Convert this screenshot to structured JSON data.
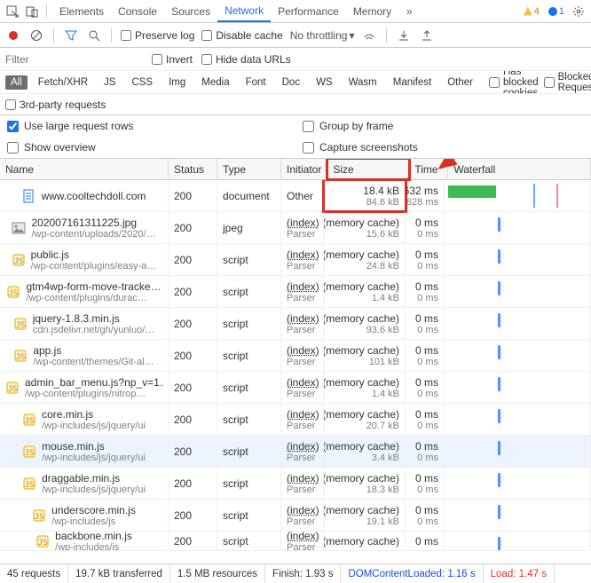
{
  "tabs": {
    "items": [
      "Elements",
      "Console",
      "Sources",
      "Network",
      "Performance",
      "Memory"
    ],
    "active": "Network",
    "warn_count": "4",
    "info_count": "1"
  },
  "toolbar": {
    "preserve_log": "Preserve log",
    "disable_cache": "Disable cache",
    "throttling": "No throttling"
  },
  "filter": {
    "placeholder": "Filter",
    "invert": "Invert",
    "hide_data_urls": "Hide data URLs",
    "kinds": [
      "All",
      "Fetch/XHR",
      "JS",
      "CSS",
      "Img",
      "Media",
      "Font",
      "Doc",
      "WS",
      "Wasm",
      "Manifest",
      "Other"
    ],
    "kinds_active": "All",
    "blocked_cookies": "Has blocked cookies",
    "blocked_req": "Blocked Requests",
    "third_party": "3rd-party requests"
  },
  "options": {
    "large_rows": "Use large request rows",
    "group_frame": "Group by frame",
    "show_overview": "Show overview",
    "capture": "Capture screenshots"
  },
  "columns": {
    "name": "Name",
    "status": "Status",
    "type": "Type",
    "initiator": "Initiator",
    "size": "Size",
    "time": "Time",
    "waterfall": "Waterfall"
  },
  "rows": [
    {
      "icon": "doc",
      "name": "www.cooltechdoll.com",
      "path": "",
      "status": "200",
      "type": "document",
      "init1": "Other",
      "init2": "",
      "size1": "18.4 kB",
      "size2": "84.6 kB",
      "time1": "632 ms",
      "time2": "628 ms",
      "wf": "green",
      "sizeBox": true
    },
    {
      "icon": "img",
      "name": "202007161311225.jpg",
      "path": "/wp-content/uploads/2020/…",
      "status": "200",
      "type": "jpeg",
      "init1": "(index)",
      "init2": "Parser",
      "size1": "(memory cache)",
      "size2": "15.6 kB",
      "time1": "0 ms",
      "time2": "0 ms",
      "wf": "tick"
    },
    {
      "icon": "js",
      "name": "public.js",
      "path": "/wp-content/plugins/easy-a…",
      "status": "200",
      "type": "script",
      "init1": "(index)",
      "init2": "Parser",
      "size1": "(memory cache)",
      "size2": "24.8 kB",
      "time1": "0 ms",
      "time2": "0 ms",
      "wf": "tick"
    },
    {
      "icon": "js",
      "name": "gtm4wp-form-move-tracke…",
      "path": "/wp-content/plugins/durac…",
      "status": "200",
      "type": "script",
      "init1": "(index)",
      "init2": "Parser",
      "size1": "(memory cache)",
      "size2": "1.4 kB",
      "time1": "0 ms",
      "time2": "0 ms",
      "wf": "tick"
    },
    {
      "icon": "js",
      "name": "jquery-1.8.3.min.js",
      "path": "cdn.jsdelivr.net/gh/yunluo/…",
      "status": "200",
      "type": "script",
      "init1": "(index)",
      "init2": "Parser",
      "size1": "(memory cache)",
      "size2": "93.6 kB",
      "time1": "0 ms",
      "time2": "0 ms",
      "wf": "tick"
    },
    {
      "icon": "js",
      "name": "app.js",
      "path": "/wp-content/themes/Git-al…",
      "status": "200",
      "type": "script",
      "init1": "(index)",
      "init2": "Parser",
      "size1": "(memory cache)",
      "size2": "101 kB",
      "time1": "0 ms",
      "time2": "0 ms",
      "wf": "tick"
    },
    {
      "icon": "js",
      "name": "admin_bar_menu.js?np_v=1…",
      "path": "/wp-content/plugins/nitrop…",
      "status": "200",
      "type": "script",
      "init1": "(index)",
      "init2": "Parser",
      "size1": "(memory cache)",
      "size2": "1.4 kB",
      "time1": "0 ms",
      "time2": "0 ms",
      "wf": "tick"
    },
    {
      "icon": "js",
      "name": "core.min.js",
      "path": "/wp-includes/js/jquery/ui",
      "status": "200",
      "type": "script",
      "init1": "(index)",
      "init2": "Parser",
      "size1": "(memory cache)",
      "size2": "20.7 kB",
      "time1": "0 ms",
      "time2": "0 ms",
      "wf": "tick"
    },
    {
      "icon": "js",
      "name": "mouse.min.js",
      "path": "/wp-includes/js/jquery/ui",
      "status": "200",
      "type": "script",
      "init1": "(index)",
      "init2": "Parser",
      "size1": "(memory cache)",
      "size2": "3.4 kB",
      "time1": "0 ms",
      "time2": "0 ms",
      "wf": "tick",
      "sel": true
    },
    {
      "icon": "js",
      "name": "draggable.min.js",
      "path": "/wp-includes/js/jquery/ui",
      "status": "200",
      "type": "script",
      "init1": "(index)",
      "init2": "Parser",
      "size1": "(memory cache)",
      "size2": "18.3 kB",
      "time1": "0 ms",
      "time2": "0 ms",
      "wf": "tick"
    },
    {
      "icon": "js",
      "name": "underscore.min.js",
      "path": "/wp-includes/js",
      "status": "200",
      "type": "script",
      "init1": "(index)",
      "init2": "Parser",
      "size1": "(memory cache)",
      "size2": "19.1 kB",
      "time1": "0 ms",
      "time2": "0 ms",
      "wf": "tick"
    },
    {
      "icon": "js",
      "name": "backbone.min.js",
      "path": "/wp-includes/js",
      "status": "200",
      "type": "script",
      "init1": "(index)",
      "init2": "Parser",
      "size1": "(memory cache)",
      "size2": "",
      "time1": "0 ms",
      "time2": "",
      "wf": "tick",
      "cut": true
    }
  ],
  "status": {
    "requests": "45 requests",
    "transferred": "19.7 kB transferred",
    "resources": "1.5 MB resources",
    "finish": "Finish: 1.93 s",
    "dom": "DOMContentLoaded: 1.16 s",
    "load": "Load: 1.47 s"
  },
  "annotation": {
    "highlight_column": "Size"
  }
}
